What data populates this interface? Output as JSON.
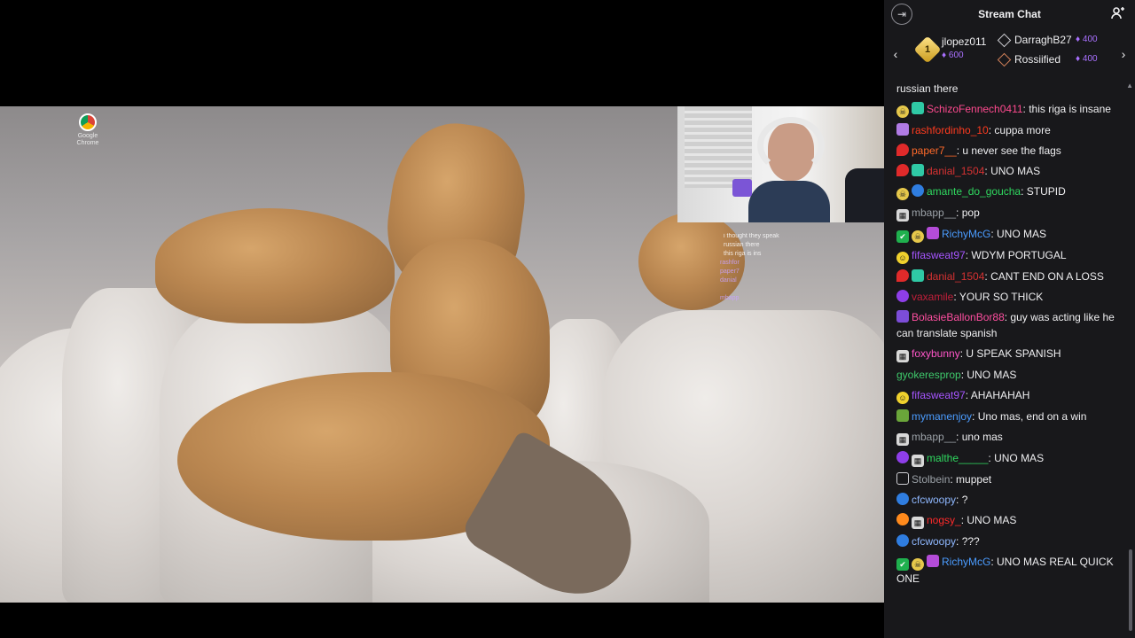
{
  "video": {
    "desktop_icon_label": "Google Chrome",
    "mini_chat": [
      {
        "user": "",
        "text": "i thought they speak"
      },
      {
        "user": "",
        "text": "russian there"
      },
      {
        "user": "",
        "text": "this riga is ins"
      },
      {
        "user": "rashfor",
        "text": ""
      },
      {
        "user": "paper7",
        "text": ""
      },
      {
        "user": "danial",
        "text": ""
      },
      {
        "user": "",
        "text": ""
      },
      {
        "user": "mbapp",
        "text": ""
      },
      {
        "user": "",
        "text": ""
      }
    ]
  },
  "chat": {
    "title": "Stream Chat",
    "collapse_icon": "collapse-arrow-icon",
    "users_icon": "users-icon",
    "leaderboard": {
      "first": {
        "rank": "1",
        "name": "jlopez011",
        "points": "600"
      },
      "second": {
        "name": "DarraghB27",
        "points": "400"
      },
      "third": {
        "name": "Rossiified",
        "points": "400"
      }
    },
    "messages": [
      {
        "badges": [],
        "user": "",
        "color": "#efeff1",
        "text": "russian there"
      },
      {
        "badges": [
          "skull",
          "teal"
        ],
        "user": "SchizoFennech0411",
        "color": "#ff4a8f",
        "text": "this riga is insane"
      },
      {
        "badges": [
          "mauve"
        ],
        "user": "rashfordinho_10",
        "color": "#ff3b1f",
        "text": "cuppa more"
      },
      {
        "badges": [
          "red"
        ],
        "user": "paper7__",
        "color": "#ff6a2a",
        "text": "u never see the flags"
      },
      {
        "badges": [
          "red",
          "teal"
        ],
        "user": "danial_1504",
        "color": "#d63232",
        "text": "UNO MAS"
      },
      {
        "badges": [
          "skull",
          "shield"
        ],
        "user": "amante_do_goucha",
        "color": "#2fd85f",
        "text": "STUPID"
      },
      {
        "badges": [
          "gray"
        ],
        "user": "mbapp__",
        "color": "#9aa0a6",
        "text": "pop"
      },
      {
        "badges": [
          "green",
          "skull",
          "gift"
        ],
        "user": "RichyMcG",
        "color": "#4b9cff",
        "text": "UNO MAS"
      },
      {
        "badges": [
          "yellow"
        ],
        "user": "fifasweat97",
        "color": "#a655ff",
        "text": "WDYM PORTUGAL"
      },
      {
        "badges": [
          "red",
          "teal"
        ],
        "user": "danial_1504",
        "color": "#d63232",
        "text": "CANT END ON A LOSS"
      },
      {
        "badges": [
          "purple"
        ],
        "user": "vaxamile",
        "color": "#c21f3a",
        "text": "YOUR SO THICK"
      },
      {
        "badges": [
          "globe"
        ],
        "user": "BolasieBallonBor88",
        "color": "#ff4fa0",
        "text": "guy was acting like he can translate spanish"
      },
      {
        "badges": [
          "gray"
        ],
        "user": "foxybunny",
        "color": "#ff55c8",
        "text": "U SPEAK SPANISH"
      },
      {
        "badges": [],
        "user": "gyokeresprop",
        "color": "#3ec96b",
        "text": "UNO MAS"
      },
      {
        "badges": [
          "yellow"
        ],
        "user": "fifasweat97",
        "color": "#a655ff",
        "text": "AHAHAHAH"
      },
      {
        "badges": [
          "grn2"
        ],
        "user": "mymanenjoy",
        "color": "#4b9cff",
        "text": "Uno mas, end on a win"
      },
      {
        "badges": [
          "gray"
        ],
        "user": "mbapp__",
        "color": "#9aa0a6",
        "text": "uno mas"
      },
      {
        "badges": [
          "purple",
          "gray"
        ],
        "user": "malthe_____",
        "color": "#2fd85f",
        "text": "UNO MAS"
      },
      {
        "badges": [
          "outline"
        ],
        "user": "Stolbein",
        "color": "#9aa0a6",
        "text": "muppet"
      },
      {
        "badges": [
          "shield"
        ],
        "user": "cfcwoopy",
        "color": "#8fb8ff",
        "text": "?"
      },
      {
        "badges": [
          "orange",
          "gray"
        ],
        "user": "nogsy_",
        "color": "#ff2a2a",
        "text": "UNO MAS"
      },
      {
        "badges": [
          "shield"
        ],
        "user": "cfcwoopy",
        "color": "#8fb8ff",
        "text": "???"
      },
      {
        "badges": [
          "green",
          "skull",
          "gift"
        ],
        "user": "RichyMcG",
        "color": "#4b9cff",
        "text": "UNO MAS REAL QUICK ONE"
      }
    ]
  }
}
